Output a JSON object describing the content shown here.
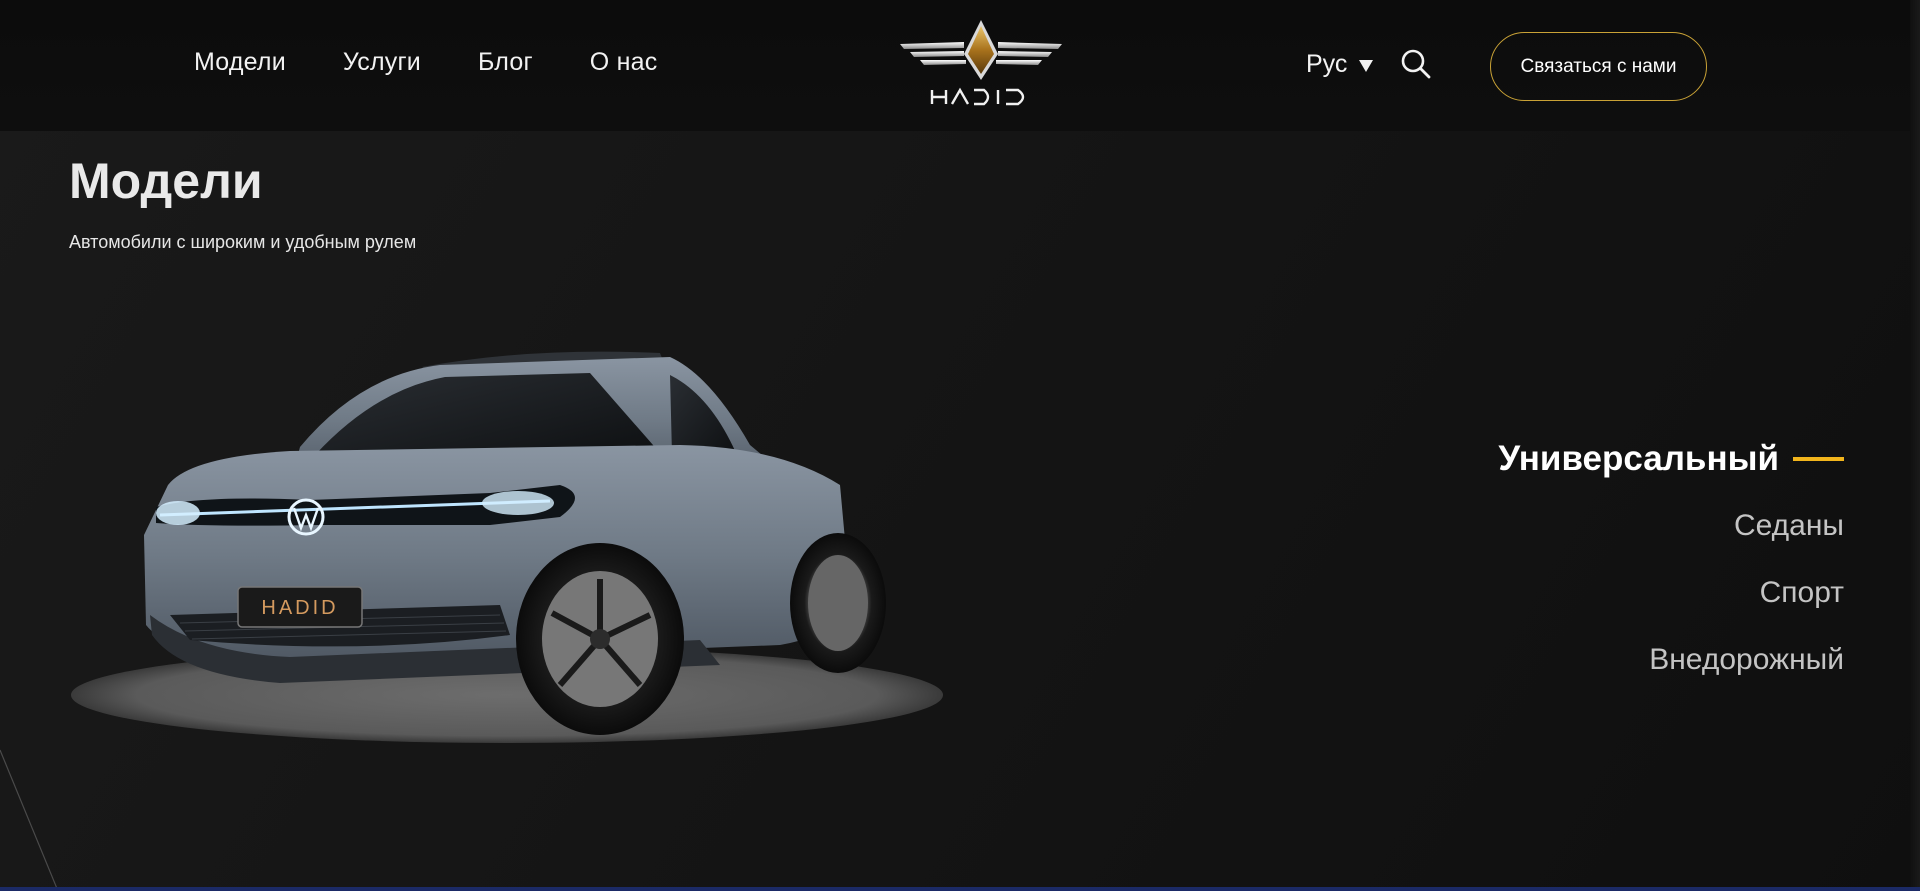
{
  "header": {
    "nav": [
      "Модели",
      "Услуги",
      "Блог",
      "О нас"
    ],
    "logo_text": "HADID",
    "language": "Рус",
    "contact_label": "Связаться с нами"
  },
  "main": {
    "title": "Модели",
    "subtitle": "Автомобили с широким и удобным рулем",
    "car_plate": "HADID",
    "categories": [
      {
        "label": "Универсальный",
        "active": true
      },
      {
        "label": "Седаны",
        "active": false
      },
      {
        "label": "Спорт",
        "active": false
      },
      {
        "label": "Внедорожный",
        "active": false
      }
    ]
  },
  "colors": {
    "accent": "#f2b51c",
    "button_border": "#c9a236",
    "background": "#121212"
  },
  "icons": [
    "search-icon",
    "chevron-down-icon",
    "logo-wings-icon"
  ]
}
